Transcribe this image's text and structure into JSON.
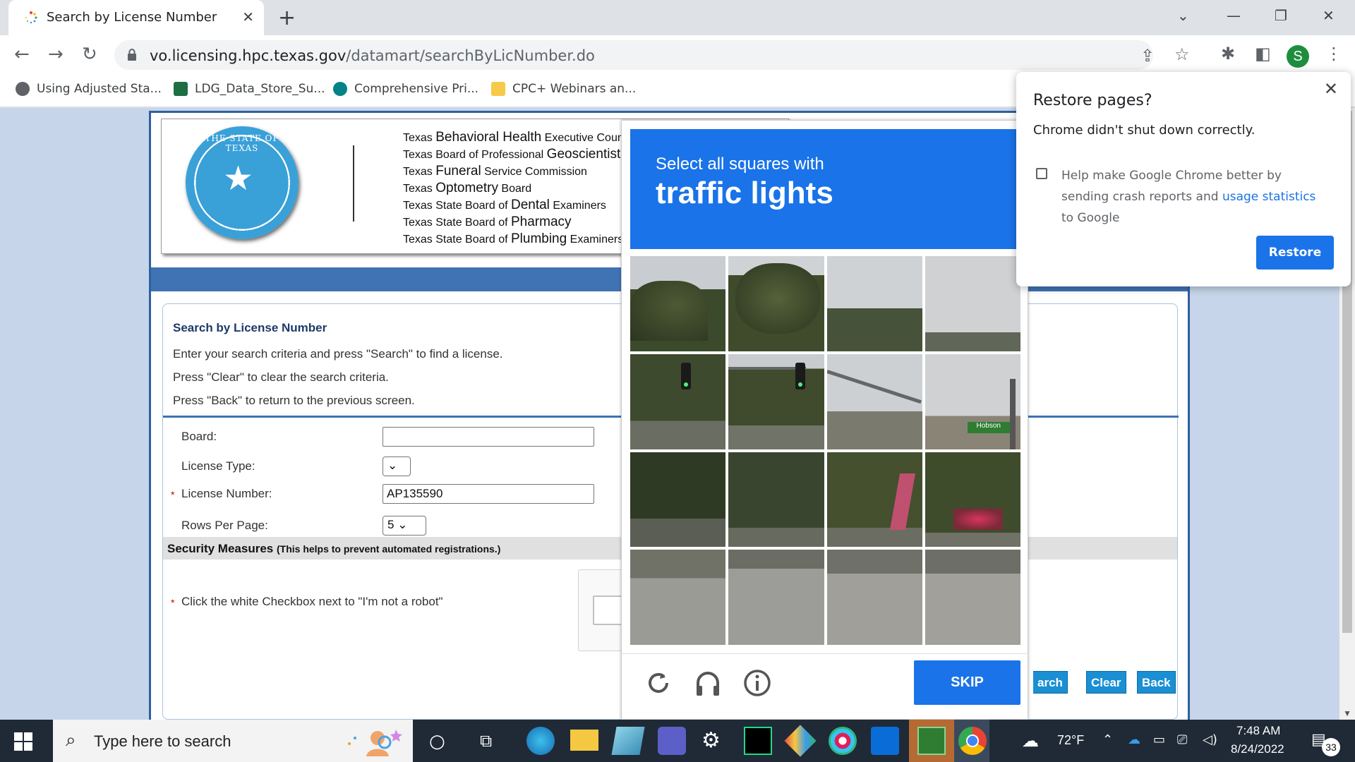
{
  "browser": {
    "tab_title": "Search by License Number",
    "tab_close": "✕",
    "new_tab": "+",
    "url_host": "vo.licensing.hpc.texas.gov",
    "url_path": "/datamart/searchByLicNumber.do",
    "profile_initial": "S",
    "bookmarks": [
      {
        "label": "Using Adjusted Sta...",
        "icon": "chrome-logo-icon"
      },
      {
        "label": "LDG_Data_Store_Su...",
        "icon": "excel-icon"
      },
      {
        "label": "Comprehensive Pri...",
        "icon": "sharepoint-icon"
      },
      {
        "label": "CPC+ Webinars an...",
        "icon": "folder-icon"
      }
    ]
  },
  "header": {
    "seal_text": "THE STATE OF TEXAS",
    "boards": [
      {
        "pre": "Texas ",
        "big": "Behavioral Health",
        "post": " Executive Council"
      },
      {
        "pre": "Texas Board of Professional ",
        "big": "Geoscientists",
        "post": ""
      },
      {
        "pre": "Texas ",
        "big": "Funeral",
        "post": " Service Commission"
      },
      {
        "pre": "Texas ",
        "big": "Optometry",
        "post": " Board"
      },
      {
        "pre": "Texas State Board of ",
        "big": "Dental",
        "post": " Examiners"
      },
      {
        "pre": "Texas State Board of ",
        "big": "Pharmacy",
        "post": ""
      },
      {
        "pre": "Texas State Board of ",
        "big": "Plumbing",
        "post": " Examiners"
      }
    ]
  },
  "search": {
    "title": "Search by License Number",
    "line1": "Enter your search criteria and press \"Search\" to find a license.",
    "line2": "Press \"Clear\" to clear the search criteria.",
    "line3": "Press \"Back\" to return to the previous screen.",
    "board_label": "Board:",
    "board_value": "",
    "license_type_label": "License Type:",
    "license_number_label": "License Number:",
    "license_number_value": "AP135590",
    "rows_label": "Rows Per Page:",
    "rows_value": "5",
    "required_mark": "*",
    "security_title": "Security Measures",
    "security_note": "(This helps to prevent automated registrations.)",
    "robot_instruction": "Click the white Checkbox next to \"I'm not a robot\"",
    "search_btn": "arch",
    "clear_btn": "Clear",
    "back_btn": "Back"
  },
  "captcha": {
    "subtitle": "Select all squares with",
    "target": "traffic lights",
    "skip": "SKIP",
    "icons": [
      "reload-icon",
      "audio-headphones-icon",
      "info-icon"
    ],
    "street_sign_text": "Hobson"
  },
  "restore_dialog": {
    "title": "Restore pages?",
    "message": "Chrome didn't shut down correctly.",
    "help_pre": "Help make Google Chrome better by sending crash reports and ",
    "help_link": "usage statistics",
    "help_post": " to Google",
    "restore_btn": "Restore",
    "close": "✕"
  },
  "taskbar": {
    "search_placeholder": "Type here to search",
    "weather": "72°F",
    "time": "7:48 AM",
    "date": "8/24/2022",
    "notifications": "33"
  }
}
